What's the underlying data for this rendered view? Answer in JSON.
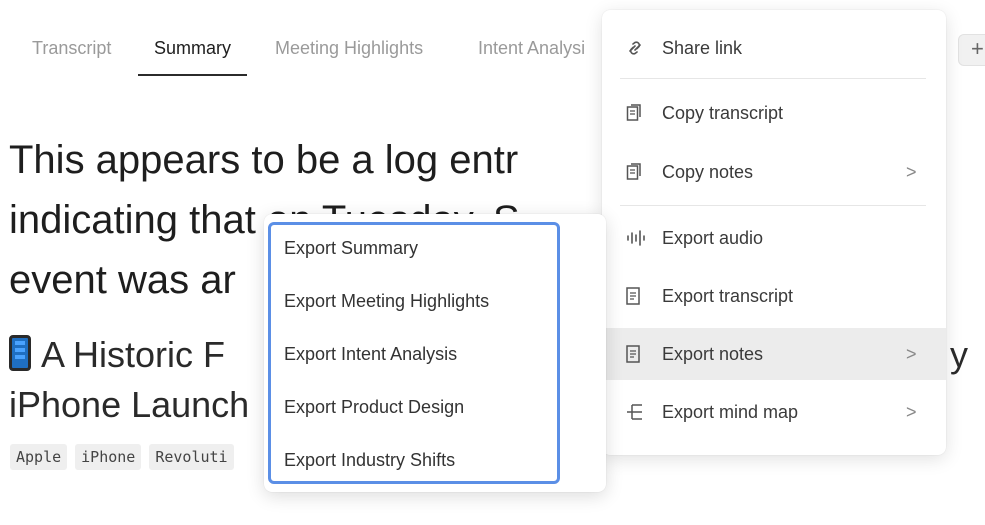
{
  "tabs": [
    {
      "label": "Transcript"
    },
    {
      "label": "Summary"
    },
    {
      "label": "Meeting Highlights"
    },
    {
      "label": "Intent Analysi"
    }
  ],
  "document": {
    "title_lines": [
      "This appears to be a log entr",
      "indicating that on Tuesday, S",
      "event was ar"
    ],
    "headline_line1": "A Historic F",
    "headline_line1_tail": "y",
    "headline_line2": "iPhone Launch",
    "tags": [
      "Apple",
      "iPhone",
      "Revoluti"
    ]
  },
  "plus_button": {
    "label": "+"
  },
  "menu": {
    "items": [
      {
        "label": "Share link",
        "icon": "link-icon"
      },
      {
        "label": "Copy transcript",
        "icon": "copy-icon"
      },
      {
        "label": "Copy notes",
        "icon": "copy-icon",
        "chevron": ">"
      },
      {
        "label": "Export audio",
        "icon": "audio-wave-icon"
      },
      {
        "label": "Export transcript",
        "icon": "document-icon"
      },
      {
        "label": "Export notes",
        "icon": "document-icon",
        "chevron": ">"
      },
      {
        "label": "Export mind map",
        "icon": "mind-map-icon",
        "chevron": ">"
      }
    ]
  },
  "submenu": {
    "items": [
      {
        "label": "Export Summary"
      },
      {
        "label": "Export Meeting Highlights"
      },
      {
        "label": "Export Intent Analysis"
      },
      {
        "label": "Export Product Design"
      },
      {
        "label": "Export Industry Shifts"
      }
    ]
  },
  "colors": {
    "accent_border": "#5b8fe6",
    "hover_bg": "#ececec"
  }
}
